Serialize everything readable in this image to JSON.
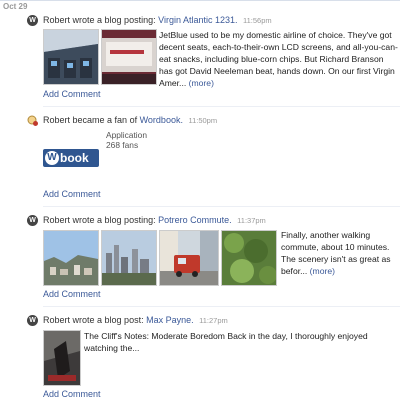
{
  "feed": {
    "date": "Oct 29",
    "stories": [
      {
        "actor": "Robert",
        "action": "wrote a blog posting:",
        "title": "Virgin Atlantic 1231.",
        "time": "11:56pm",
        "excerpt": "JetBlue used to be my domestic airline of choice. They've got decent seats, each-to-their-own LCD screens, and all-you-can-eat snacks, including blue-corn chips. But Richard Branson has got David Neeleman beat, hands down. On our first Virgin Amer...",
        "more": "(more)",
        "add_comment": "Add Comment"
      },
      {
        "actor": "Robert",
        "action": "became a fan of",
        "title": "Wordbook.",
        "time": "11:50pm",
        "meta_type": "Application",
        "meta_fans": "268 fans",
        "logo_text": "book",
        "logo_letter": "W",
        "add_comment": "Add Comment"
      },
      {
        "actor": "Robert",
        "action": "wrote a blog posting:",
        "title": "Potrero Commute.",
        "time": "11:37pm",
        "excerpt": "Finally, another walking commute, about 10 minutes. The scenery isn't as great as befor...",
        "more": "(more)",
        "add_comment": "Add Comment"
      },
      {
        "actor": "Robert",
        "action": "wrote a blog post:",
        "title": "Max Payne.",
        "time": "11:27pm",
        "excerpt": "The Cliff's Notes: Moderate Boredom Back in the day, I thoroughly enjoyed watching the...",
        "add_comment": "Add Comment"
      }
    ]
  },
  "icons": {
    "blog_app": "wordpress-icon",
    "fan": "fan-icon"
  },
  "colors": {
    "link": "#3b5998",
    "muted": "#999999",
    "logo_bg": "#2f5690"
  }
}
